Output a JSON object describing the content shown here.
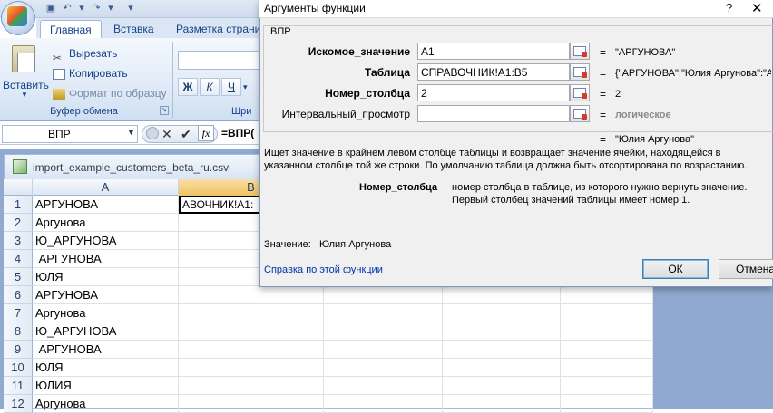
{
  "excel": {
    "tabs": [
      "Главная",
      "Вставка",
      "Разметка страни"
    ],
    "clipboard": {
      "paste_label": "Вставить",
      "cut_label": "Вырезать",
      "copy_label": "Копировать",
      "format_painter_label": "Формат по образцу",
      "group_label": "Буфер обмена"
    },
    "font_group": {
      "bold": "Ж",
      "italic": "К",
      "underline": "Ч",
      "group_label_partial": "Шри"
    },
    "namebox": "ВПР",
    "fx_label": "fx",
    "formula_partial": "=ВПР(",
    "workbook_title": "import_example_customers_beta_ru.csv",
    "columns": [
      "A",
      "B"
    ],
    "rows": [
      {
        "num": "1",
        "a": "АРГУНОВА"
      },
      {
        "num": "2",
        "a": "Аргунова"
      },
      {
        "num": "3",
        "a": "Ю_АРГУНОВА"
      },
      {
        "num": "4",
        "a": " АРГУНОВА"
      },
      {
        "num": "5",
        "a": "ЮЛЯ"
      },
      {
        "num": "6",
        "a": "АРГУНОВА"
      },
      {
        "num": "7",
        "a": "Аргунова"
      },
      {
        "num": "8",
        "a": "Ю_АРГУНОВА"
      },
      {
        "num": "9",
        "a": " АРГУНОВА"
      },
      {
        "num": "10",
        "a": "ЮЛЯ"
      },
      {
        "num": "11",
        "a": "ЮЛИЯ"
      },
      {
        "num": "12",
        "a": "Аргунова"
      }
    ],
    "cell_b1": "АВОЧНИК!A1:"
  },
  "dialog": {
    "title": "Аргументы функции",
    "help_btn": "?",
    "close_btn": "✕",
    "function_name": "ВПР",
    "args": [
      {
        "label": "Искомое_значение",
        "value": "A1",
        "result": "\"АРГУНОВА\"",
        "bold": true
      },
      {
        "label": "Таблица",
        "value": "СПРАВОЧНИК!A1:B5",
        "result": "{\"АРГУНОВА\";\"Юлия Аргунова\":\"Ар",
        "bold": true
      },
      {
        "label": "Номер_столбца",
        "value": "2",
        "result": "2",
        "bold": true
      },
      {
        "label": "Интервальный_просмотр",
        "value": "",
        "result": "логическое",
        "bold": false
      }
    ],
    "equals": "=",
    "function_result": "\"Юлия Аргунова\"",
    "description": "Ищет значение в крайнем левом столбце таблицы и возвращает значение ячейки, находящейся в указанном столбце той же строки. По умолчанию таблица должна быть отсортирована по возрастанию.",
    "arg_help_name": "Номер_столбца",
    "arg_help_text": "номер столбца в таблице, из которого нужно вернуть значение. Первый столбец значений таблицы имеет номер 1.",
    "value_label": "Значение:",
    "value_text": "Юлия Аргунова",
    "help_link": "Справка по этой функции",
    "ok_label": "ОК",
    "cancel_label": "Отмена"
  }
}
